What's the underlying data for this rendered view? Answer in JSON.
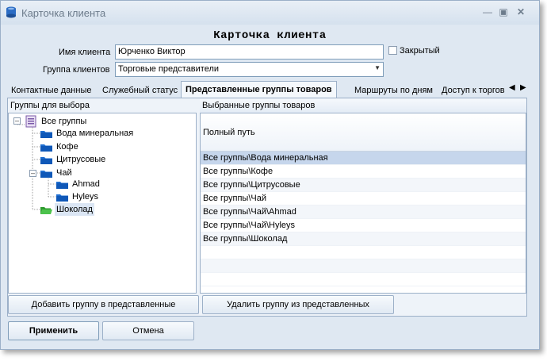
{
  "window": {
    "title": "Карточка клиента"
  },
  "form": {
    "heading": "Карточка клиента",
    "client_name_label": "Имя клиента",
    "client_name_value": "Юрченко Виктор",
    "closed_label": "Закрытый",
    "client_group_label": "Группа клиентов",
    "client_group_value": "Торговые представители"
  },
  "tabs": [
    {
      "label": "Контактные данные"
    },
    {
      "label": "Служебный статус"
    },
    {
      "label": "Представленные группы товаров"
    },
    {
      "label": "Маршруты по дням"
    },
    {
      "label": "Доступ к торгов"
    }
  ],
  "left_pane": {
    "header": "Группы для выбора",
    "tree": [
      {
        "label": "Все группы"
      },
      {
        "label": "Вода минеральная"
      },
      {
        "label": "Кофе"
      },
      {
        "label": "Цитрусовые"
      },
      {
        "label": "Чай"
      },
      {
        "label": "Ahmad"
      },
      {
        "label": "Hyleys"
      },
      {
        "label": "Шоколад"
      }
    ]
  },
  "right_pane": {
    "header": "Выбранные группы товаров",
    "column_header": "Полный путь",
    "rows": [
      "Все группы\\Вода минеральная",
      "Все группы\\Кофе",
      "Все группы\\Цитрусовые",
      "Все группы\\Чай",
      "Все группы\\Чай\\Ahmad",
      "Все группы\\Чай\\Hyleys",
      "Все группы\\Шоколад"
    ]
  },
  "buttons": {
    "add_group": "Добавить группу в представленные",
    "remove_group": "Удалить группу из представленных",
    "apply": "Применить",
    "cancel": "Отмена"
  },
  "colors": {
    "selected_row": "#c6d6ec",
    "folder_blue": "#1f6fd1",
    "folder_green": "#2e9b2e"
  }
}
